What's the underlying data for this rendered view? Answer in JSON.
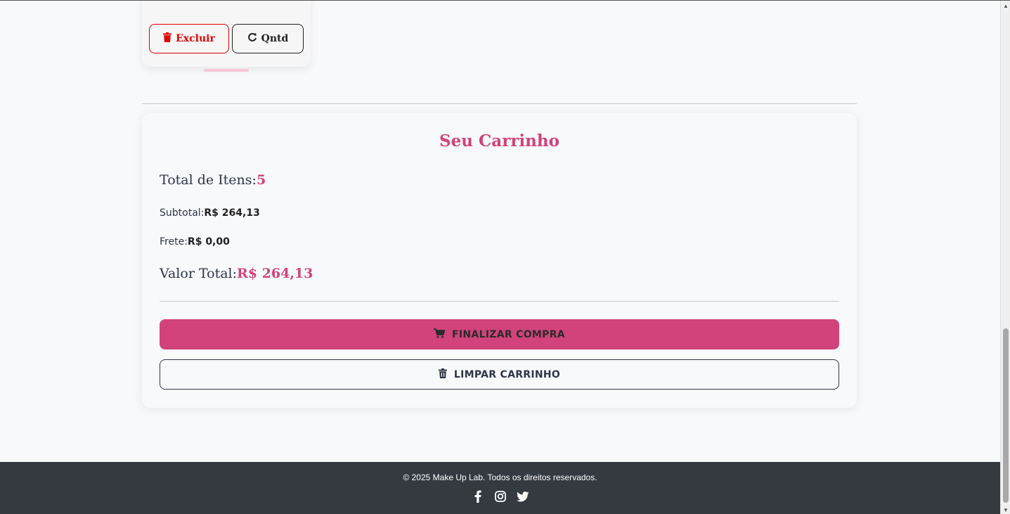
{
  "product_card": {
    "delete_label": "Excluir",
    "qty_label": "Qntd"
  },
  "cart": {
    "title": "Seu Carrinho",
    "total_items_label": "Total de Itens:",
    "total_items_value": "5",
    "subtotal_label": "Subtotal:",
    "subtotal_value": "R$ 264,13",
    "shipping_label": "Frete:",
    "shipping_value": "R$ 0,00",
    "total_label": "Valor Total:",
    "total_value": "R$ 264,13",
    "checkout_label": "FINALIZAR COMPRA",
    "clear_label": "LIMPAR CARRINHO"
  },
  "footer": {
    "copyright": "© 2025 Make Up Lab. Todos os direitos reservados.",
    "social_icons": [
      "facebook-icon",
      "instagram-icon",
      "twitter-icon"
    ]
  },
  "colors": {
    "accent": "#d1437a",
    "danger": "#e00000",
    "text_dark": "#2c3646",
    "footer_bg": "#343a40",
    "page_bg": "#f8f9fb"
  }
}
